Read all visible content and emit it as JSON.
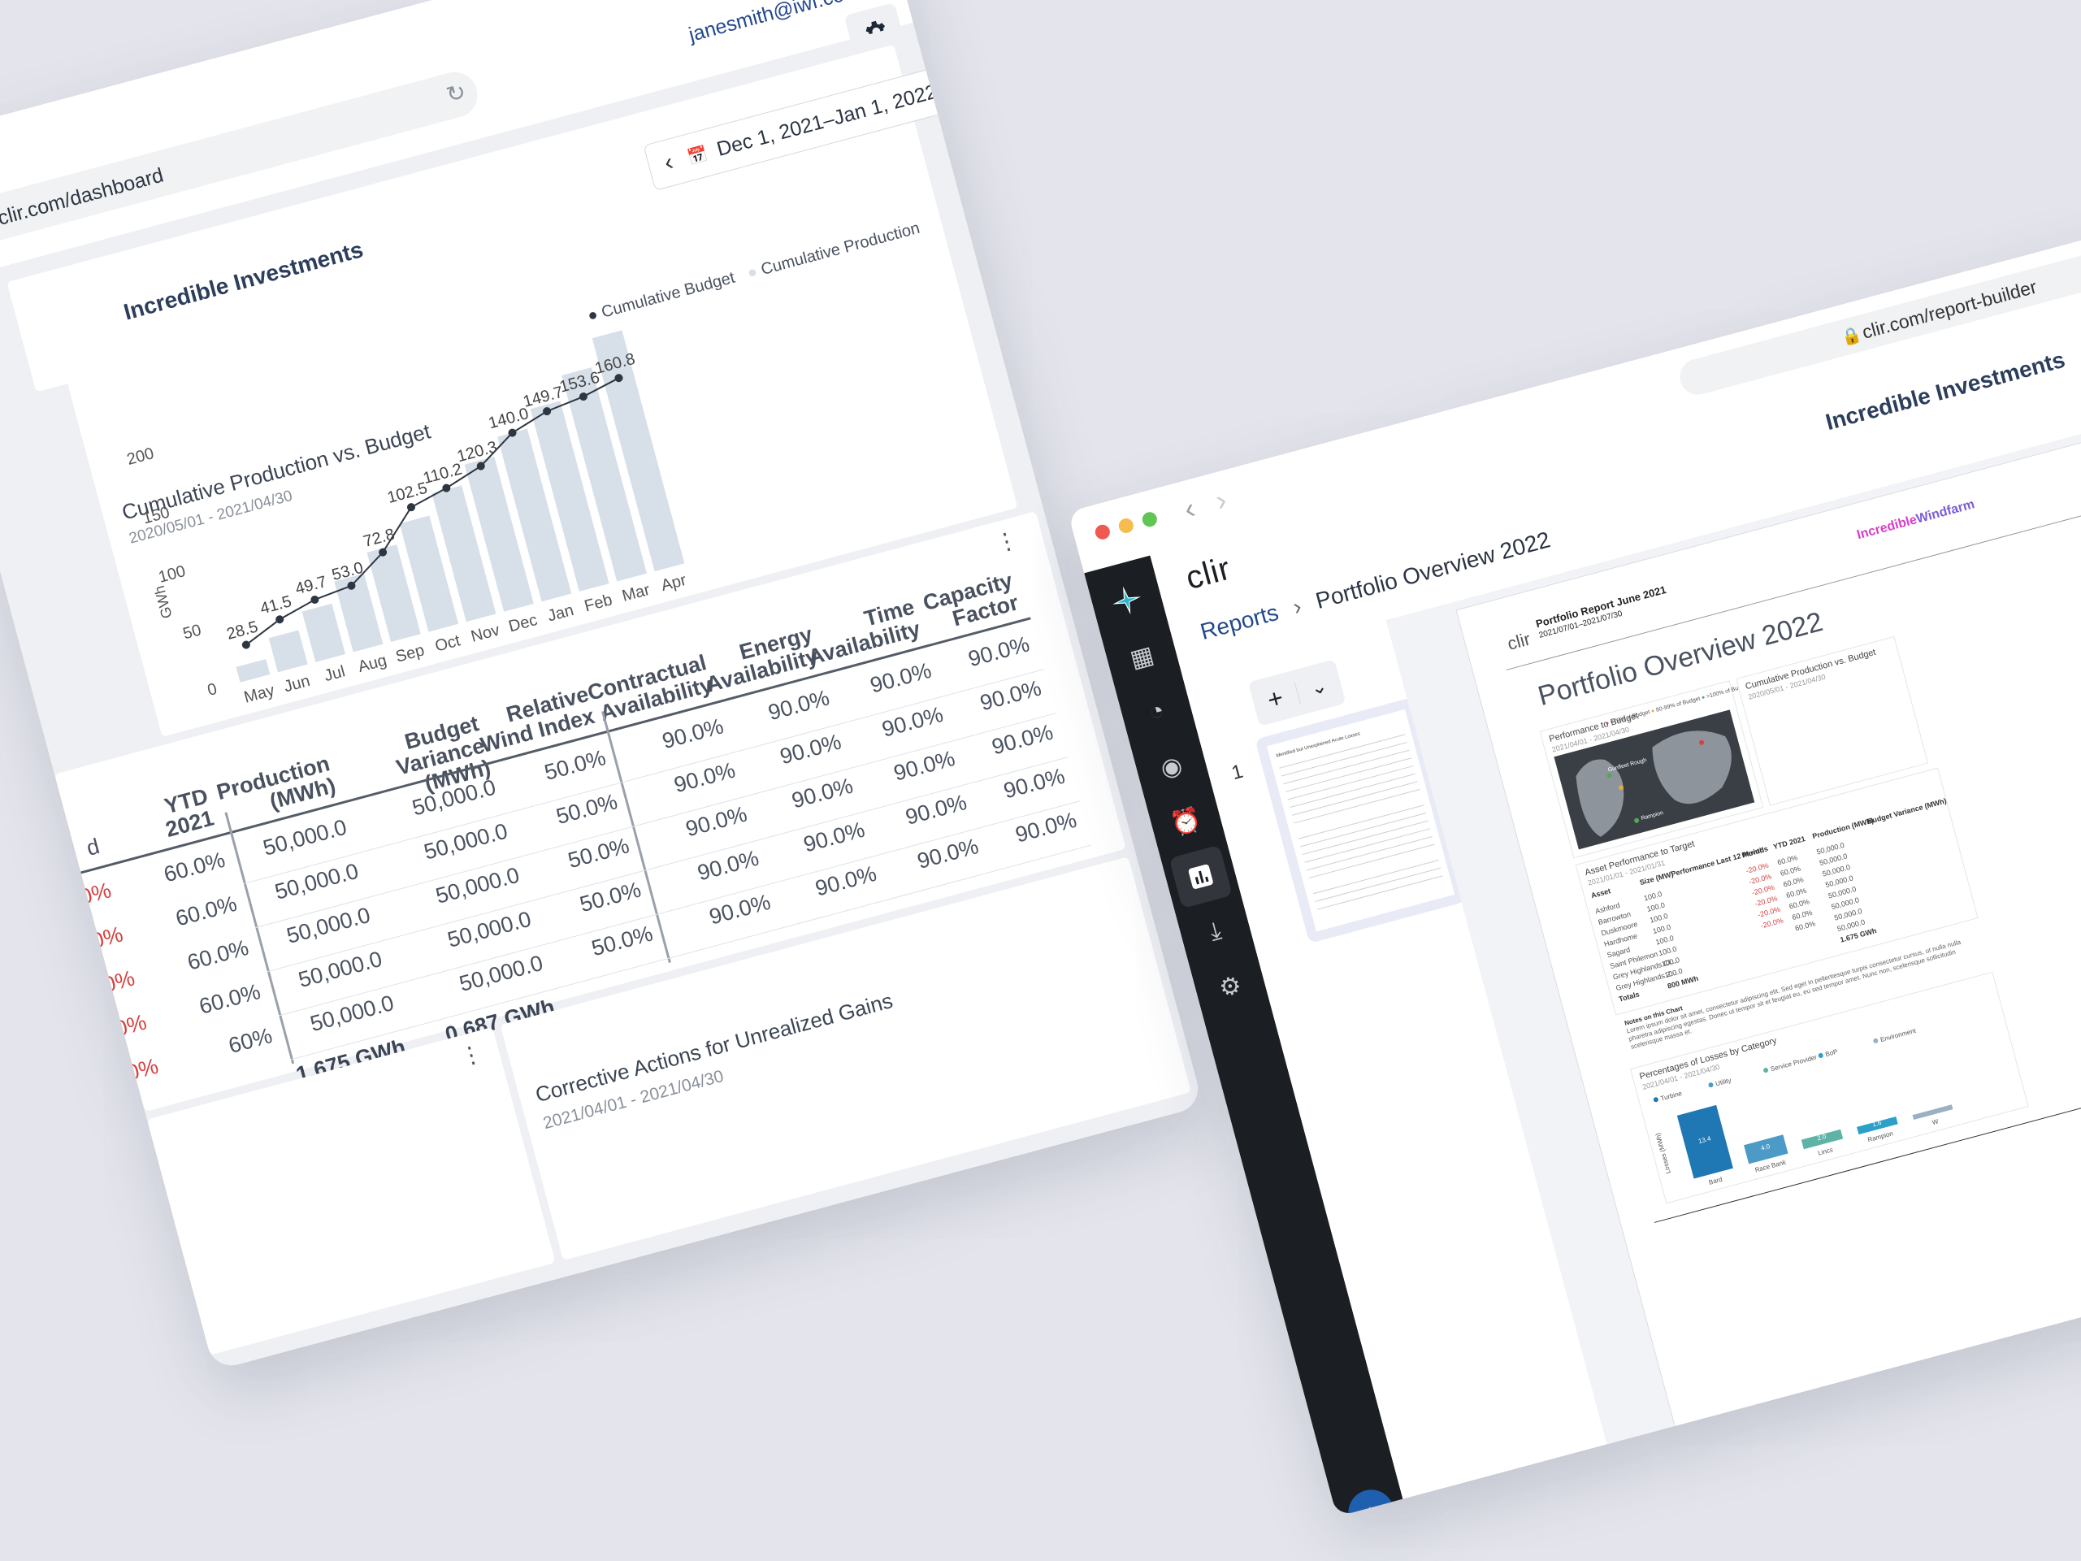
{
  "dashboard": {
    "url": "clir.com/dashboard",
    "user_email": "janesmith@iwf.com",
    "org_name": "Incredible Investments",
    "date_range": "Dec 1, 2021–Jan 1, 2022",
    "chart": {
      "title": "Cumulative Production vs. Budget",
      "subtitle": "2020/05/01 - 2021/04/30",
      "legend_budget": "Cumulative Budget",
      "legend_production": "Cumulative Production",
      "ylabel": "GWh"
    },
    "table": {
      "headers": {
        "ytd": [
          "YTD",
          "2021"
        ],
        "production": [
          "Production",
          "(MWh)"
        ],
        "budget_variance": [
          "Budget Variance",
          "(MWh)"
        ],
        "relative_wind": [
          "Relative",
          "Wind Index"
        ],
        "contractual": [
          "Contractual",
          "Availability"
        ],
        "energy": [
          "Energy",
          "Availability"
        ],
        "time": [
          "Time",
          "Availability"
        ],
        "capacity": [
          "Capacity",
          "Factor"
        ]
      },
      "period_col": [
        "d",
        "0%",
        "0.0%",
        "20.0%",
        "-20.0%",
        "-20.0%"
      ],
      "ytd_col": [
        "60.0%",
        "60.0%",
        "60.0%",
        "60.0%",
        "60%"
      ],
      "production_col": [
        "50,000.0",
        "50,000.0",
        "50,000.0",
        "50,000.0",
        "50,000.0",
        "1.675 GWh"
      ],
      "budget_col": [
        "50,000.0",
        "50,000.0",
        "50,000.0",
        "50,000.0",
        "50,000.0",
        "0.687 GWh"
      ],
      "wind_col": [
        "50.0%",
        "50.0%",
        "50.0%",
        "50.0%",
        "50.0%"
      ],
      "contractual_col": [
        "90.0%",
        "90.0%",
        "90.0%",
        "90.0%",
        "90.0%"
      ],
      "energy_col": [
        "90.0%",
        "90.0%",
        "90.0%",
        "90.0%",
        "90.0%"
      ],
      "time_col": [
        "90.0%",
        "90.0%",
        "90.0%",
        "90.0%",
        "90.0%"
      ],
      "capacity_col": [
        "90.0%",
        "90.0%",
        "90.0%",
        "90.0%",
        "90.0%"
      ]
    },
    "corrective": {
      "title": "Corrective Actions for Unrealized Gains",
      "subtitle": "2021/04/01 - 2021/04/30"
    }
  },
  "chart_data": {
    "type": "bar",
    "title": "Cumulative Production vs. Budget",
    "subtitle": "2020/05/01 - 2021/04/30",
    "ylabel": "GWh",
    "categories": [
      "May",
      "Jun",
      "Jul",
      "Aug",
      "Sep",
      "Oct",
      "Nov",
      "Dec",
      "Jan",
      "Feb",
      "Mar",
      "Apr"
    ],
    "series": [
      {
        "name": "Cumulative Production",
        "kind": "bar",
        "values": [
          13,
          29,
          43,
          60,
          76,
          92,
          109,
          125,
          140,
          155,
          175,
          198
        ]
      },
      {
        "name": "Cumulative Budget",
        "kind": "line",
        "values": [
          28.5,
          41.5,
          49.7,
          53.0,
          72.8,
          102.5,
          110.2,
          120.3,
          140.0,
          149.7,
          153.6,
          160.8
        ]
      }
    ],
    "ylim": [
      0,
      200
    ],
    "yticks": [
      0,
      50,
      100,
      150,
      200
    ],
    "legend": "top-right",
    "colors": {
      "bar": "#d7dfe8",
      "line": "#2e3642"
    }
  },
  "report_builder": {
    "url": "clir.com/report-builder",
    "org_name": "Incredible Investments",
    "logo": "clir",
    "breadcrumb_link": "Reports",
    "breadcrumb_current": "Portfolio Overview 2022",
    "thumb_number": "1",
    "thumb_caption": "Identified but Unexplained Acute Losses",
    "doc": {
      "brand": "clir",
      "report_title": "Portfolio  Report June 2021",
      "report_range": "2021/07/01–2021/07/30",
      "windfarm_a": "Incredible",
      "windfarm_b": "Windfarm",
      "page_title": "Portfolio Overview 2022",
      "perf_title": "Performance to Budget",
      "perf_sub": "2021/04/01 - 2021/04/30",
      "perf_legend": [
        "<79% of Budget",
        "80-99% of Budget",
        ">100% of Budget"
      ],
      "map_labels": [
        "Gunfleet Rough",
        "Rampion"
      ],
      "cum_title": "Cumulative Production vs. Budget",
      "cum_sub": "2020/05/01 - 2021/04/30",
      "asset_title": "Asset Performance to Target",
      "asset_sub": "2021/01/01 - 2021/01/31",
      "asset_headers": [
        "Asset",
        "Size (MW)",
        "Performance Last 12 Months",
        "Period",
        "YTD 2021",
        "Production (MWh)",
        "Budget Variance (MWh)"
      ],
      "assets": [
        "Ashford",
        "Barrowton",
        "Duskmoore",
        "Hardhome",
        "Sagard",
        "Saint Philemon",
        "Grey Highlands Cl...",
        "Grey Highlands Z..."
      ],
      "asset_size": [
        "100.0",
        "100.0",
        "100.0",
        "100.0",
        "100.0",
        "100.0",
        "100.0",
        "100.0"
      ],
      "asset_period": [
        "-20.0%",
        "-20.0%",
        "-20.0%",
        "-20.0%",
        "-20.0%",
        "-20.0%"
      ],
      "asset_ytd": [
        "60.0%",
        "60.0%",
        "60.0%",
        "60.0%",
        "60.0%",
        "60.0%",
        "60.0%"
      ],
      "asset_prod": [
        "50,000.0",
        "50,000.0",
        "50,000.0",
        "50,000.0",
        "50,000.0",
        "50,000.0",
        "50,000.0",
        "50,000.0"
      ],
      "totals_label": "Totals",
      "totals_size": "800 MWh",
      "totals_prod": "1.675 GWh",
      "notes_title": "Notes on this Chart",
      "notes_text": "Lorem ipsum dolor sit amet, consectetur adipiscing elit. Sed eget in pellentesque turpis consectetur cursus, ut nulla nulla pharetra adipiscing egestas. Donec ut tempor sit et feugiat eu, eu sed tempor amet. Nunc non, scelerisque sollicitudin scelerisque massa et.",
      "loss_title": "Percentages of Losses by Category",
      "loss_sub": "2021/04/01 - 2021/04/30",
      "loss_legend": [
        "Turbine",
        "Utility",
        "Service Provider",
        "BoP",
        "Environment"
      ],
      "loss_ylabel": "Losses (MWh)",
      "loss_cats": [
        "Bard",
        "Race Bank",
        "Lincs",
        "Rampion",
        "W"
      ],
      "loss_vals": [
        "13.4",
        "4.0",
        "2.0",
        "1.6"
      ]
    }
  }
}
